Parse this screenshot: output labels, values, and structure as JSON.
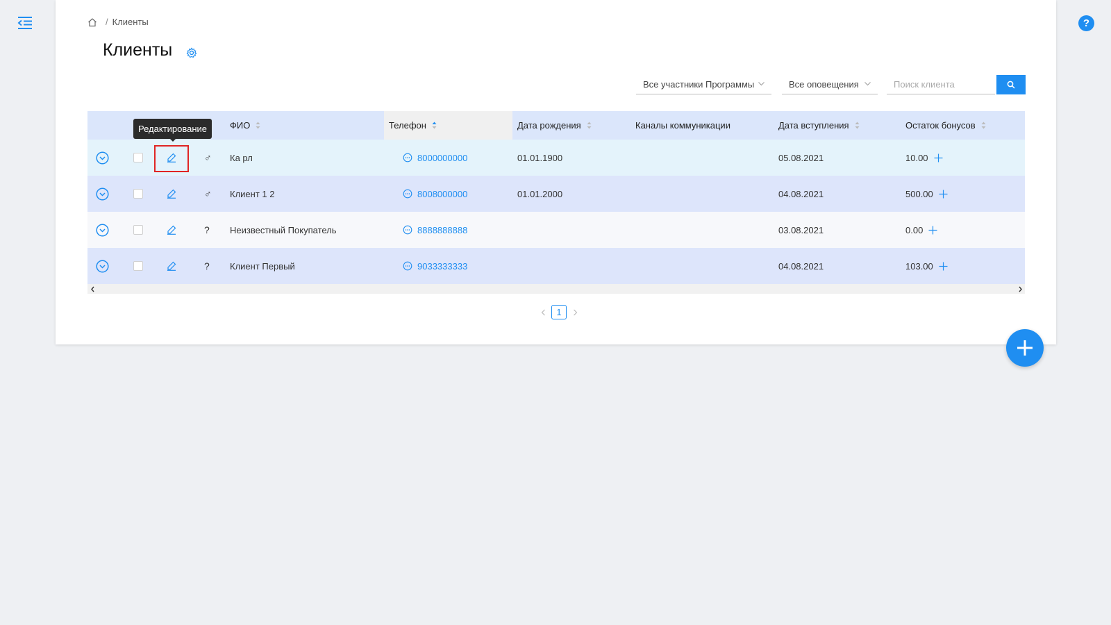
{
  "breadcrumb": {
    "home_icon": "home-icon",
    "separator": "/",
    "current": "Клиенты"
  },
  "page": {
    "title": "Клиенты",
    "settings_icon": "gear-icon"
  },
  "filters": {
    "members_select": "Все участники Программы",
    "notifications_select": "Все оповещения",
    "search_placeholder": "Поиск клиента",
    "search_icon": "search-icon"
  },
  "table": {
    "columns": {
      "name": "ФИО",
      "phone": "Телефон",
      "birth": "Дата рождения",
      "channels": "Каналы коммуникации",
      "joined": "Дата вступления",
      "bonus": "Остаток бонусов"
    },
    "rows": [
      {
        "gender": "♂",
        "name": "Ка рл",
        "phone": "8000000000",
        "birth": "01.01.1900",
        "joined": "05.08.2021",
        "bonus": "10.00",
        "bg": "#e4f3fb"
      },
      {
        "gender": "♂",
        "name": "Клиент 1 2",
        "phone": "8008000000",
        "birth": "01.01.2000",
        "joined": "04.08.2021",
        "bonus": "500.00",
        "bg": "#dde5fb"
      },
      {
        "gender": "?",
        "name": "Неизвестный Покупатель",
        "phone": "8888888888",
        "birth": "",
        "joined": "03.08.2021",
        "bonus": "0.00",
        "bg": "#f7f8fb"
      },
      {
        "gender": "?",
        "name": "Клиент Первый",
        "phone": "9033333333",
        "birth": "",
        "joined": "04.08.2021",
        "bonus": "103.00",
        "bg": "#dde5fb"
      }
    ]
  },
  "pagination": {
    "current": "1"
  },
  "tooltip": {
    "text": "Редактирование"
  },
  "colors": {
    "accent": "#1f8ef1",
    "header_bg": "#dbe6fb",
    "highlight": "#e02424"
  }
}
